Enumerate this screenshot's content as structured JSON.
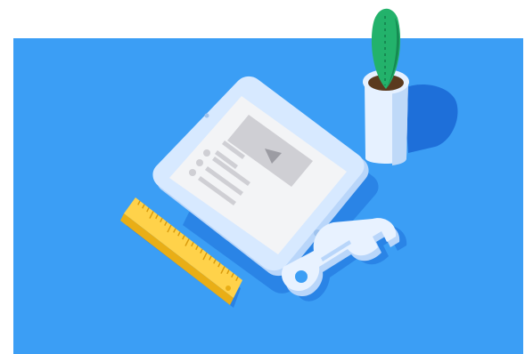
{
  "scene": {
    "colors": {
      "page_background": "#FFFFFF",
      "blue_background": "#3B9EF5",
      "shadow_blue": "#1E6FD9",
      "tablet_frame": "#D7E9FF",
      "tablet_frame_shade": "#B9D6FA",
      "tablet_screen": "#F3F4F6",
      "screen_content_gray": "#CFCFD4",
      "ruler_yellow": "#FFD24A",
      "ruler_shade": "#E9AE16",
      "wrench_light": "#E8F2FF",
      "wrench_shade": "#B9D6FA",
      "pot_white": "#E6F1FF",
      "pot_shade": "#BFD9F8",
      "soil_brown": "#5B3A1E",
      "cactus_green": "#23B26B",
      "cactus_dark": "#168A52"
    },
    "objects": [
      {
        "name": "tablet",
        "icon": "tablet-illustration"
      },
      {
        "name": "ruler",
        "icon": "ruler-illustration"
      },
      {
        "name": "wrench",
        "icon": "wrench-illustration"
      },
      {
        "name": "potted-cactus",
        "icon": "cactus-plant-illustration"
      }
    ]
  }
}
